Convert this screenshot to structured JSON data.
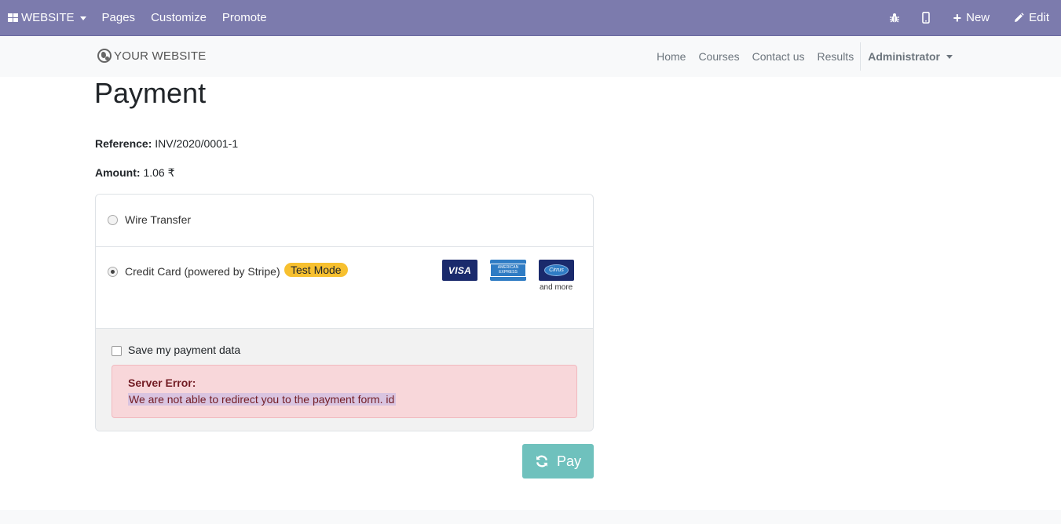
{
  "topbar": {
    "website_label": "WEBSITE",
    "menu": [
      "Pages",
      "Customize",
      "Promote"
    ],
    "debug_icon": "bug-icon",
    "mobile_icon": "mobile-icon",
    "new_label": "New",
    "edit_label": "Edit",
    "bg_color": "#7c7bad"
  },
  "header": {
    "logo_text": "YOUR WEBSITE",
    "nav": [
      "Home",
      "Courses",
      "Contact us",
      "Results"
    ],
    "user": "Administrator"
  },
  "page": {
    "title": "Payment",
    "reference_label": "Reference:",
    "reference_value": "INV/2020/0001-1",
    "amount_label": "Amount:",
    "amount_value": "1.06 ₹"
  },
  "acquirers": [
    {
      "label": "Wire Transfer",
      "selected": false
    },
    {
      "label": "Credit Card (powered by Stripe)",
      "selected": true,
      "badge": "Test Mode"
    }
  ],
  "card_logos": {
    "visa": "VISA",
    "amex": "AMERICAN EXPRESS",
    "cirrus": "Cirrus",
    "more": "and more"
  },
  "save_payment_label": "Save my payment data",
  "alert": {
    "title": "Server Error:",
    "message": "We are not able to redirect you to the payment form. id"
  },
  "pay_button": {
    "label": "Pay",
    "color": "#6fc1bd"
  }
}
